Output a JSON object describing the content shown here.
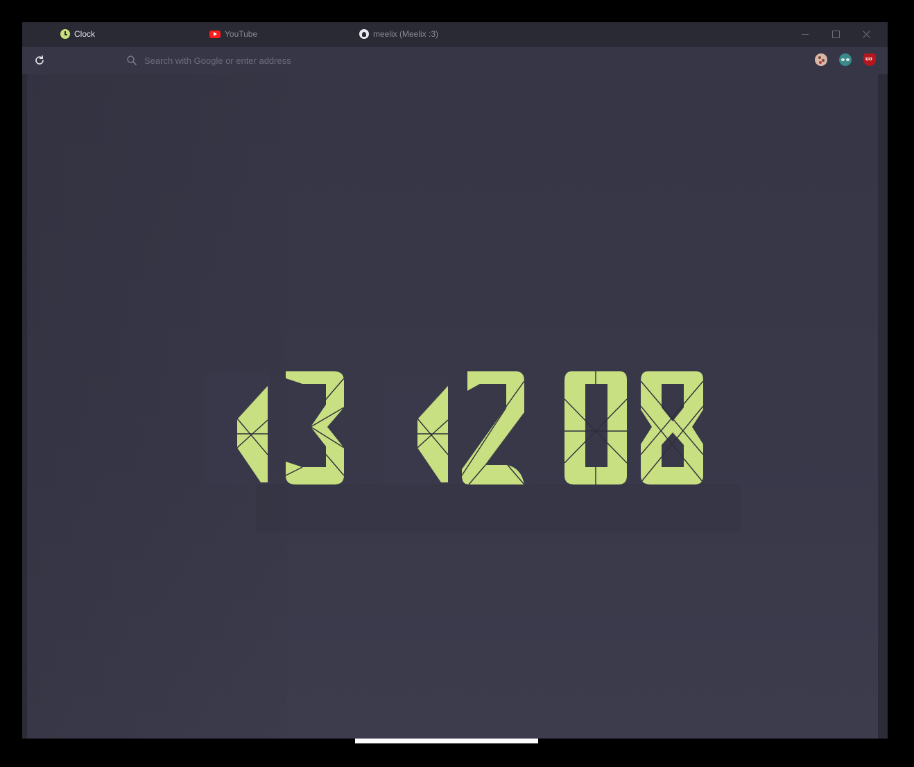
{
  "window": {
    "tabs": [
      {
        "label": "Clock",
        "icon": "clock-icon",
        "active": true
      },
      {
        "label": "YouTube",
        "icon": "youtube-icon",
        "active": false
      },
      {
        "label": "meelix (Meelix :3)",
        "icon": "github-icon",
        "active": false
      }
    ],
    "controls": [
      "minimize",
      "maximize",
      "close"
    ]
  },
  "navbar": {
    "reload_icon": "reload-icon",
    "search_icon": "search-icon",
    "search_placeholder": "Search with Google or enter address",
    "extensions": [
      "cookie-extension-icon",
      "glasses-extension-icon",
      "ublock-origin-icon"
    ]
  },
  "clock": {
    "time": "13 12 08",
    "hours": "13",
    "minutes": "12",
    "seconds": "08",
    "digit_color": "#c8df82",
    "background_color": "#363646"
  }
}
